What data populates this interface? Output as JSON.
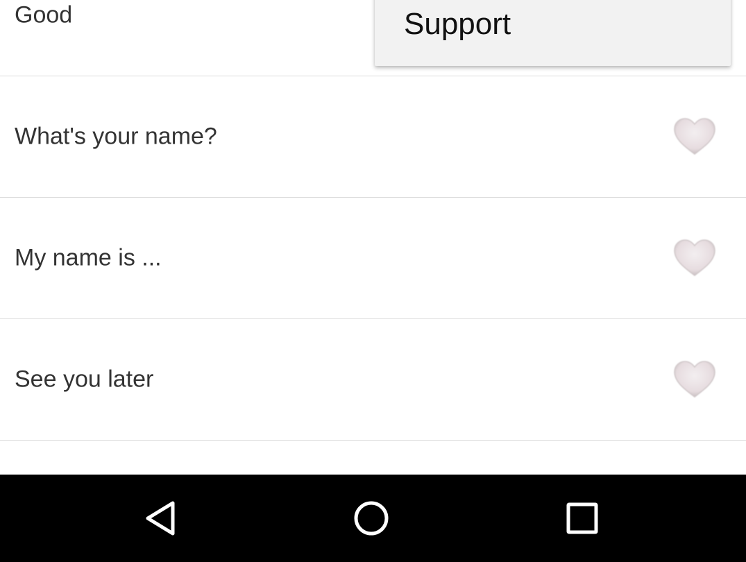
{
  "phrases": [
    {
      "text": "Good",
      "favorite": false
    },
    {
      "text": "What's your name?",
      "favorite": false
    },
    {
      "text": "My name is ...",
      "favorite": false
    },
    {
      "text": "See you later",
      "favorite": false
    }
  ],
  "menu": {
    "items": [
      {
        "label": "Support"
      }
    ]
  },
  "navbar": {
    "buttons": [
      "back-icon",
      "home-icon",
      "recents-icon"
    ]
  },
  "colors": {
    "heart": "#e8e0e2",
    "menu_bg": "#f2f2f2",
    "navbar_bg": "#000000"
  }
}
